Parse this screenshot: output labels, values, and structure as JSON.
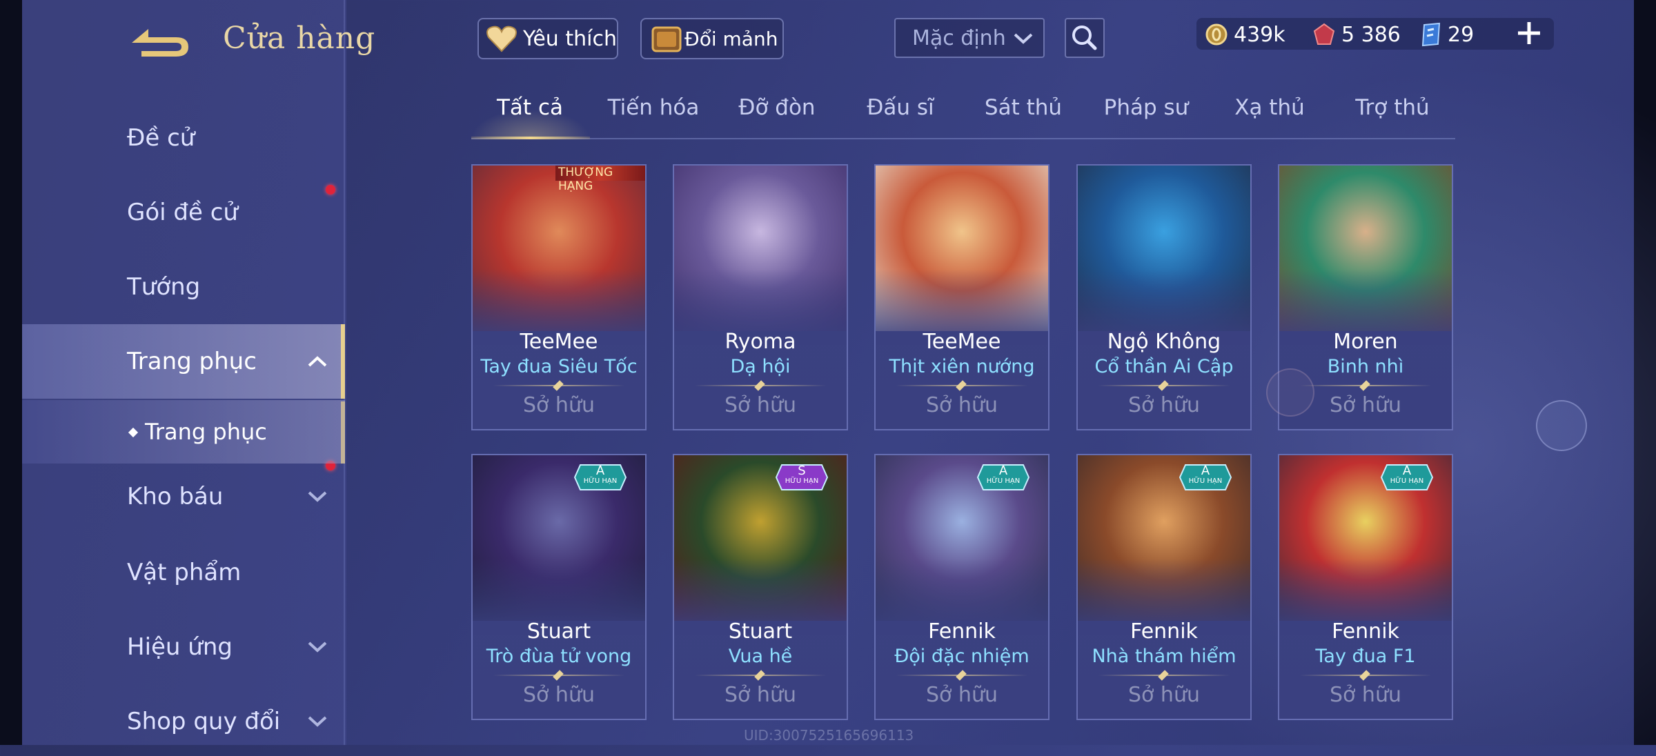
{
  "header": {
    "title": "Cửa hàng"
  },
  "toolbar": {
    "favorites_label": "Yêu thích",
    "exchange_label": "Đổi mảnh",
    "sort_value": "Mặc định"
  },
  "currencies": [
    {
      "name": "gold-coin",
      "value": "439k"
    },
    {
      "name": "ruby",
      "value": "5 386"
    },
    {
      "name": "voucher",
      "value": "29"
    }
  ],
  "sidebar": {
    "items": [
      {
        "label": "Đề cử",
        "has_dot": false,
        "expandable": false
      },
      {
        "label": "Gói đề cử",
        "has_dot": true,
        "expandable": false
      },
      {
        "label": "Tướng",
        "has_dot": false,
        "expandable": false
      },
      {
        "label": "Trang phục",
        "has_dot": false,
        "expandable": true,
        "expanded": true,
        "active": true
      },
      {
        "label": "Kho báu",
        "has_dot": true,
        "expandable": true
      },
      {
        "label": "Vật phẩm",
        "has_dot": false,
        "expandable": false
      },
      {
        "label": "Hiệu ứng",
        "has_dot": false,
        "expandable": true
      },
      {
        "label": "Shop quy đổi",
        "has_dot": false,
        "expandable": true
      }
    ],
    "sub_item": "Trang phục"
  },
  "tabs": [
    {
      "label": "Tất cả",
      "active": true
    },
    {
      "label": "Tiến hóa"
    },
    {
      "label": "Đỡ đòn"
    },
    {
      "label": "Đấu sĩ"
    },
    {
      "label": "Sát thủ"
    },
    {
      "label": "Pháp sư"
    },
    {
      "label": "Xạ thủ"
    },
    {
      "label": "Trợ thủ"
    }
  ],
  "cards": [
    {
      "hero": "TeeMee",
      "skin": "Tay đua Siêu Tốc",
      "status": "Sở hữu",
      "badge": "THƯỢNG HẠNG",
      "palette": [
        "#b8362e",
        "#e08a5a",
        "#5a2a3a"
      ]
    },
    {
      "hero": "Ryoma",
      "skin": "Dạ hội",
      "status": "Sở hữu",
      "badge": "",
      "palette": [
        "#6a5a9a",
        "#c7b7e0",
        "#3e2f6a"
      ]
    },
    {
      "hero": "TeeMee",
      "skin": "Thịt xiên nướng",
      "status": "Sở hữu",
      "badge": "",
      "palette": [
        "#c95a3a",
        "#f0c48a",
        "#e8e0d0"
      ]
    },
    {
      "hero": "Ngộ Không",
      "skin": "Cổ thần Ai Cập",
      "status": "Sở hữu",
      "badge": "",
      "palette": [
        "#1f5a9a",
        "#3aa0e0",
        "#20304a"
      ]
    },
    {
      "hero": "Moren",
      "skin": "Binh nhì",
      "status": "Sở hữu",
      "badge": "",
      "palette": [
        "#2e8a6a",
        "#d8b08a",
        "#7a4a2a"
      ]
    },
    {
      "hero": "Stuart",
      "skin": "Trò đùa tử vong",
      "status": "Sở hữu",
      "tier": "A",
      "tier_sub": "HỮU HẠN",
      "palette": [
        "#3a2a6a",
        "#6a6aa8",
        "#1e1e3a"
      ]
    },
    {
      "hero": "Stuart",
      "skin": "Vua hề",
      "status": "Sở hữu",
      "tier": "S",
      "tier_sub": "HỮU HẠN",
      "palette": [
        "#2a4a2a",
        "#c0a030",
        "#5a1a1a"
      ]
    },
    {
      "hero": "Fennik",
      "skin": "Đội đặc nhiệm",
      "status": "Sở hữu",
      "tier": "A",
      "tier_sub": "HỮU HẠN",
      "palette": [
        "#5a4a8a",
        "#9ab0e0",
        "#2a3050"
      ]
    },
    {
      "hero": "Fennik",
      "skin": "Nhà thám hiểm",
      "status": "Sở hữu",
      "tier": "A",
      "tier_sub": "HỮU HẠN",
      "palette": [
        "#8a4a2a",
        "#e0a060",
        "#3a2a2a"
      ]
    },
    {
      "hero": "Fennik",
      "skin": "Tay đua F1",
      "status": "Sở hữu",
      "tier": "A",
      "tier_sub": "HỮU HẠN",
      "palette": [
        "#c03030",
        "#e8d060",
        "#3a2a3a"
      ]
    }
  ],
  "footer": {
    "uid": "UID:3007525165696113"
  },
  "colors": {
    "accent_gold": "#e9d7a6",
    "skin_name": "#8ee0ff",
    "notify_dot": "#e0233a"
  }
}
